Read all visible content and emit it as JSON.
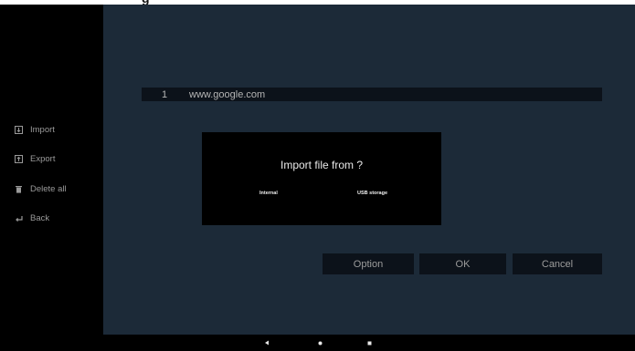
{
  "title_fragment": "g",
  "sidebar": {
    "items": [
      {
        "label": "Import",
        "icon": "import-icon"
      },
      {
        "label": "Export",
        "icon": "export-icon"
      },
      {
        "label": "Delete all",
        "icon": "trash-icon"
      },
      {
        "label": "Back",
        "icon": "back-arrow-icon"
      }
    ]
  },
  "list": {
    "rows": [
      {
        "index": "1",
        "url": "www.google.com"
      }
    ]
  },
  "dialog": {
    "title": "Import file from ?",
    "options": [
      "Internal",
      "USB storage"
    ]
  },
  "buttons": {
    "option": "Option",
    "ok": "OK",
    "cancel": "Cancel"
  },
  "navbar": {
    "icons": [
      "back-triangle-icon",
      "home-dot-icon",
      "recents-square-icon"
    ]
  },
  "colors": {
    "main_bg": "#1c2a38",
    "row_bg": "#0c121a",
    "sidebar_bg": "#000000"
  }
}
